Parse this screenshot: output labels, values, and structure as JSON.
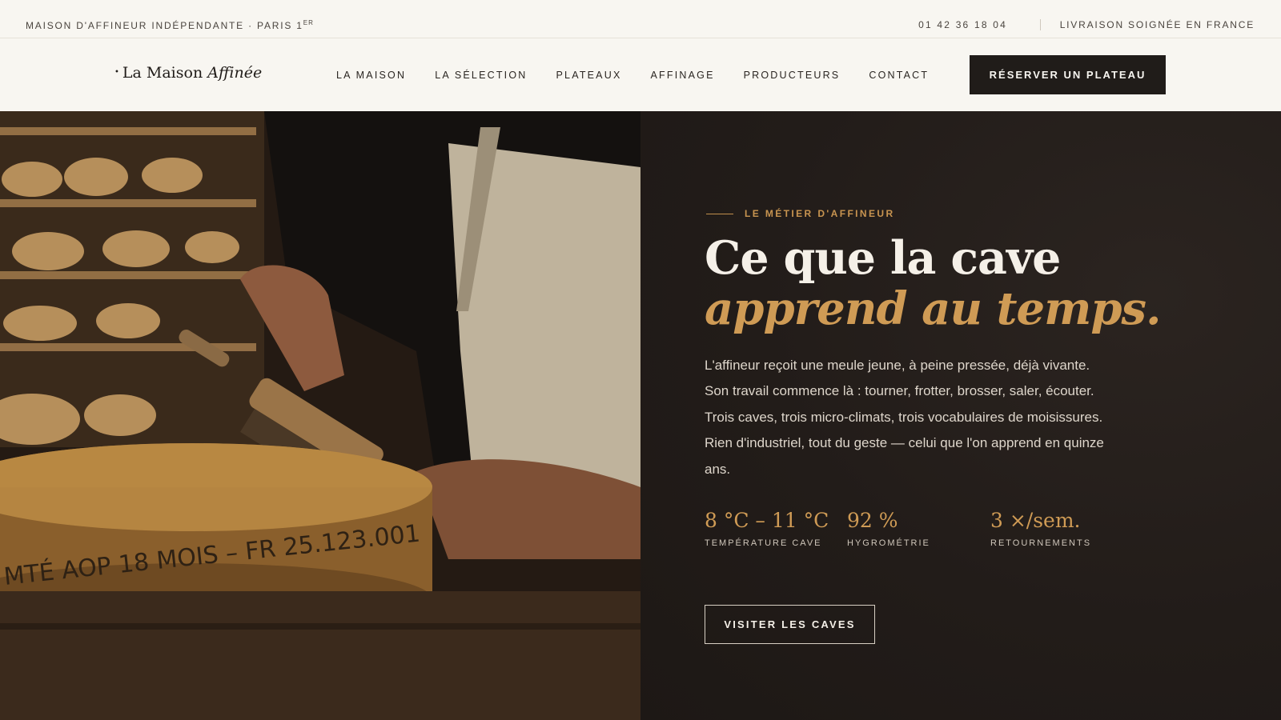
{
  "topbar": {
    "tagline": "MAISON D'AFFINEUR INDÉPENDANTE · PARIS 1",
    "tagline_sup": "ER",
    "phone": "01 42 36 18 04",
    "shipping": "LIVRAISON SOIGNÉE EN FRANCE"
  },
  "brand": {
    "dot": "•",
    "name": "La Maison",
    "name_italic": "Affinée"
  },
  "nav": {
    "items": [
      "LA MAISON",
      "LA SÉLECTION",
      "PLATEAUX",
      "AFFINAGE",
      "PRODUCTEURS",
      "CONTACT"
    ],
    "cta": "RÉSERVER UN PLATEAU"
  },
  "hero": {
    "eyebrow": "LE MÉTIER D'AFFINEUR",
    "title_line1": "Ce que la cave",
    "title_line2": "apprend au temps.",
    "body": "L'affineur reçoit une meule jeune, à peine pressée, déjà vivante. Son travail commence là : tourner, frotter, brosser, saler, écouter. Trois caves, trois micro-climats, trois vocabulaires de moisissures. Rien d'industriel, tout du geste — celui que l'on apprend en quinze ans.",
    "stats": [
      {
        "value": "8 °C – 11 °C",
        "label": "TEMPÉRATURE CAVE"
      },
      {
        "value": "92 %",
        "label": "HYGROMÉTRIE"
      },
      {
        "value": "3 ×/sem.",
        "label": "RETOURNEMENTS"
      }
    ],
    "cta": "VISITER LES CAVES",
    "photo_stamp": "MTÉ AOP 18 MOIS – FR 25.123.001"
  },
  "colors": {
    "accent": "#cf9b55",
    "dark": "#201c19",
    "cream": "#f8f6f1"
  }
}
